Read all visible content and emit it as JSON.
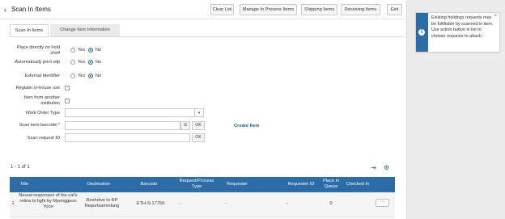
{
  "header": {
    "back_glyph": "‹",
    "title": "Scan In Items",
    "buttons": {
      "clear_list": "Clear List",
      "manage_in_process": "Manage In Process Items",
      "shipping_items": "Shipping Items",
      "receiving_items": "Receiving Items",
      "exit": "Exit"
    }
  },
  "tabs": {
    "scan_in_items": "Scan In Items",
    "change_item_information": "Change Item Information"
  },
  "form": {
    "place_on_hold_shelf": {
      "label": "Place directly on hold shelf",
      "yes": "Yes",
      "no": "No",
      "selected": "No"
    },
    "auto_print_slip": {
      "label": "Automatically print slip",
      "yes": "Yes",
      "no": "No",
      "selected": "No"
    },
    "external_identifier": {
      "label": "External Identifier",
      "yes": "Yes",
      "no": "No",
      "selected": "No"
    },
    "register_in_house_use": {
      "label": "Register in-house use",
      "checked": false
    },
    "item_from_another_institution": {
      "label": "Item from another institution",
      "checked": false
    },
    "work_order_type": {
      "label": "Work Order Type",
      "value": "",
      "caret": "▾"
    },
    "scan_item_barcode": {
      "label": "Scan item barcode",
      "required_mark": "*",
      "value": "",
      "list_icon": "☰",
      "ok": "OK"
    },
    "scan_request_id": {
      "label": "Scan request ID",
      "value": "",
      "ok": "OK"
    },
    "create_item": "Create Item"
  },
  "results": {
    "count": "1 - 1 of 1",
    "export_icon": "⇥",
    "settings_icon": "⚙"
  },
  "table": {
    "columns": [
      "Title",
      "Destination",
      "Barcode",
      "Request/Process Type",
      "Requester",
      "Requester ID",
      "Place in Queue",
      "Checked In"
    ],
    "rows": [
      {
        "index": "1",
        "title": "Neural responses of the cat's retina to light by Myonggeun Yoon",
        "destination": "Reshelve to RP Reportsammlung",
        "barcode": "ETH-S-17759",
        "request_type": "-",
        "requester": "-",
        "requester_id": "-",
        "place_in_queue": "0",
        "checked_in": "",
        "actions": "···"
      }
    ]
  },
  "notice": {
    "icon": "i",
    "close": "×",
    "text": "Existing holdings requests may be fulfillable by scanned in item. Use action button in list to choose requests to attach."
  }
}
